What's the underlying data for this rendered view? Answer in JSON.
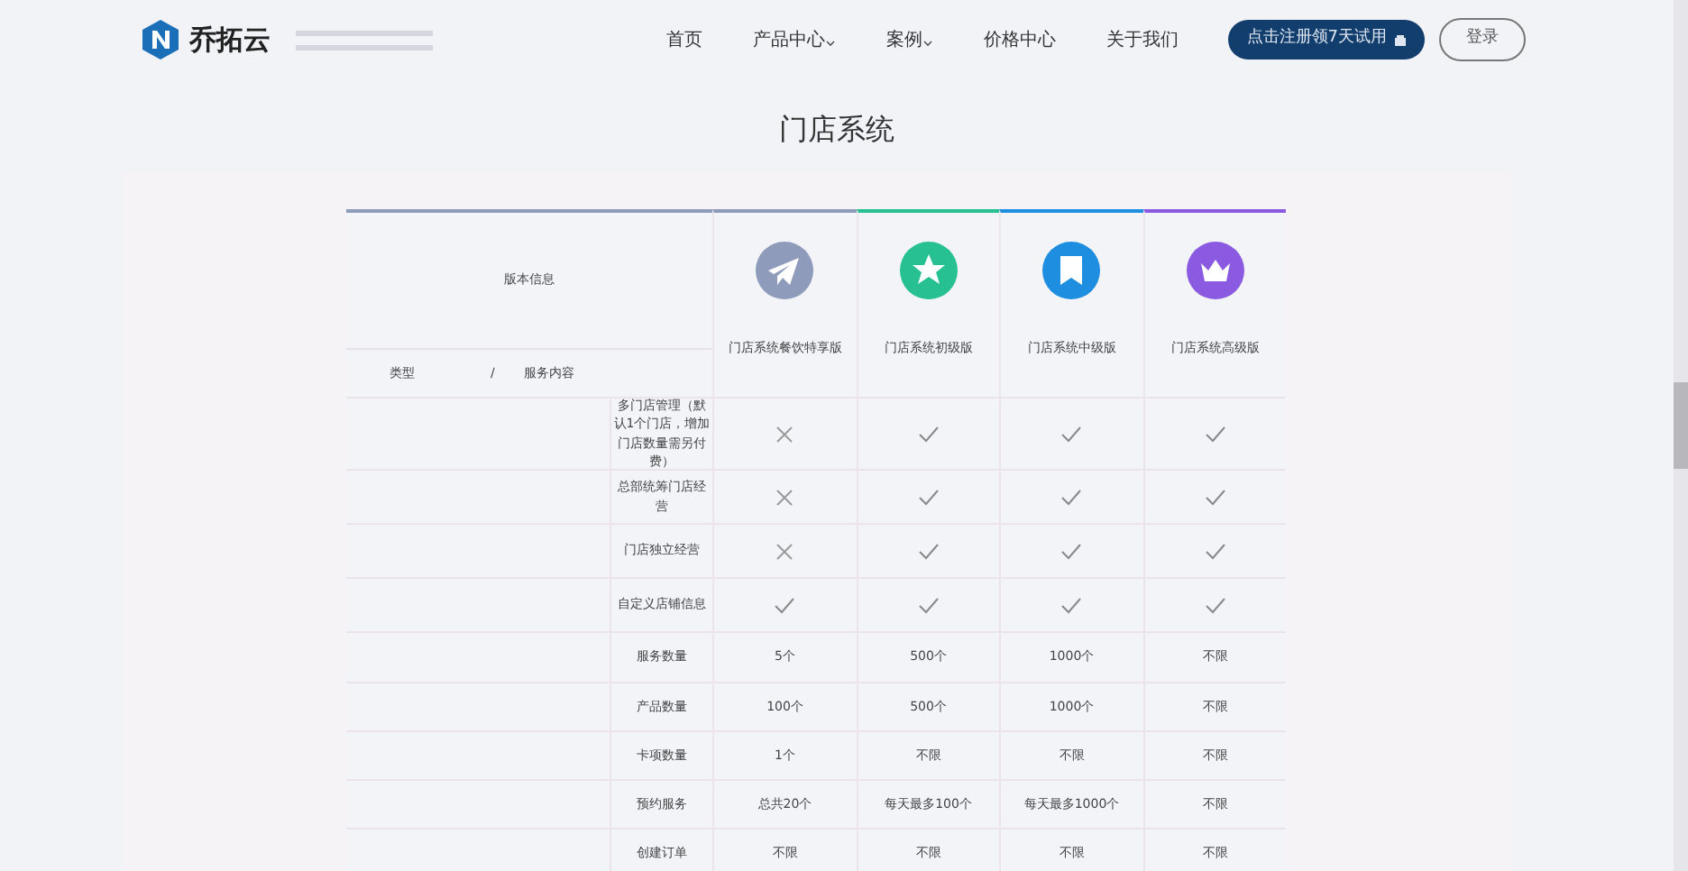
{
  "header": {
    "brand": "乔拓云",
    "nav": [
      {
        "label": "首页",
        "dropdown": false
      },
      {
        "label": "产品中心",
        "dropdown": true
      },
      {
        "label": "案例",
        "dropdown": true
      },
      {
        "label": "价格中心",
        "dropdown": false
      },
      {
        "label": "关于我们",
        "dropdown": false
      }
    ],
    "trial_button": "点击注册领7天试用",
    "login_button": "登录"
  },
  "page_title": "门店系统",
  "table": {
    "version_label": "版本信息",
    "type_label": "类型",
    "separator": "/",
    "content_label": "服务内容",
    "plans": [
      {
        "name": "门店系统餐饮特享版",
        "color": "#8e9bbb"
      },
      {
        "name": "门店系统初级版",
        "color": "#26c092"
      },
      {
        "name": "门店系统中级版",
        "color": "#1e8fe0"
      },
      {
        "name": "门店系统高级版",
        "color": "#8a5be0"
      }
    ],
    "rows": [
      {
        "feature": "多门店管理（默认1个门店，增加门店数量需另付费）",
        "cells": [
          {
            "kind": "mark",
            "checked": false
          },
          {
            "kind": "mark",
            "checked": true
          },
          {
            "kind": "mark",
            "checked": true
          },
          {
            "kind": "mark",
            "checked": true
          }
        ]
      },
      {
        "feature": "总部统筹门店经营",
        "cells": [
          {
            "kind": "mark",
            "checked": false
          },
          {
            "kind": "mark",
            "checked": true
          },
          {
            "kind": "mark",
            "checked": true
          },
          {
            "kind": "mark",
            "checked": true
          }
        ]
      },
      {
        "feature": "门店独立经营",
        "cells": [
          {
            "kind": "mark",
            "checked": false
          },
          {
            "kind": "mark",
            "checked": true
          },
          {
            "kind": "mark",
            "checked": true
          },
          {
            "kind": "mark",
            "checked": true
          }
        ]
      },
      {
        "feature": "自定义店铺信息",
        "cells": [
          {
            "kind": "mark",
            "checked": true
          },
          {
            "kind": "mark",
            "checked": true
          },
          {
            "kind": "mark",
            "checked": true
          },
          {
            "kind": "mark",
            "checked": true
          }
        ]
      },
      {
        "feature": "服务数量",
        "cells": [
          {
            "kind": "text",
            "text": "5个"
          },
          {
            "kind": "text",
            "text": "500个"
          },
          {
            "kind": "text",
            "text": "1000个"
          },
          {
            "kind": "text",
            "text": "不限"
          }
        ]
      },
      {
        "feature": "产品数量",
        "cells": [
          {
            "kind": "text",
            "text": "100个"
          },
          {
            "kind": "text",
            "text": "500个"
          },
          {
            "kind": "text",
            "text": "1000个"
          },
          {
            "kind": "text",
            "text": "不限"
          }
        ]
      },
      {
        "feature": "卡项数量",
        "cells": [
          {
            "kind": "text",
            "text": "1个"
          },
          {
            "kind": "text",
            "text": "不限"
          },
          {
            "kind": "text",
            "text": "不限"
          },
          {
            "kind": "text",
            "text": "不限"
          }
        ]
      },
      {
        "feature": "预约服务",
        "cells": [
          {
            "kind": "text",
            "text": "总共20个"
          },
          {
            "kind": "text",
            "text": "每天最多100个"
          },
          {
            "kind": "text",
            "text": "每天最多1000个"
          },
          {
            "kind": "text",
            "text": "不限"
          }
        ]
      },
      {
        "feature": "创建订单",
        "cells": [
          {
            "kind": "text",
            "text": "不限"
          },
          {
            "kind": "text",
            "text": "不限"
          },
          {
            "kind": "text",
            "text": "不限"
          },
          {
            "kind": "text",
            "text": "不限"
          }
        ]
      }
    ]
  }
}
